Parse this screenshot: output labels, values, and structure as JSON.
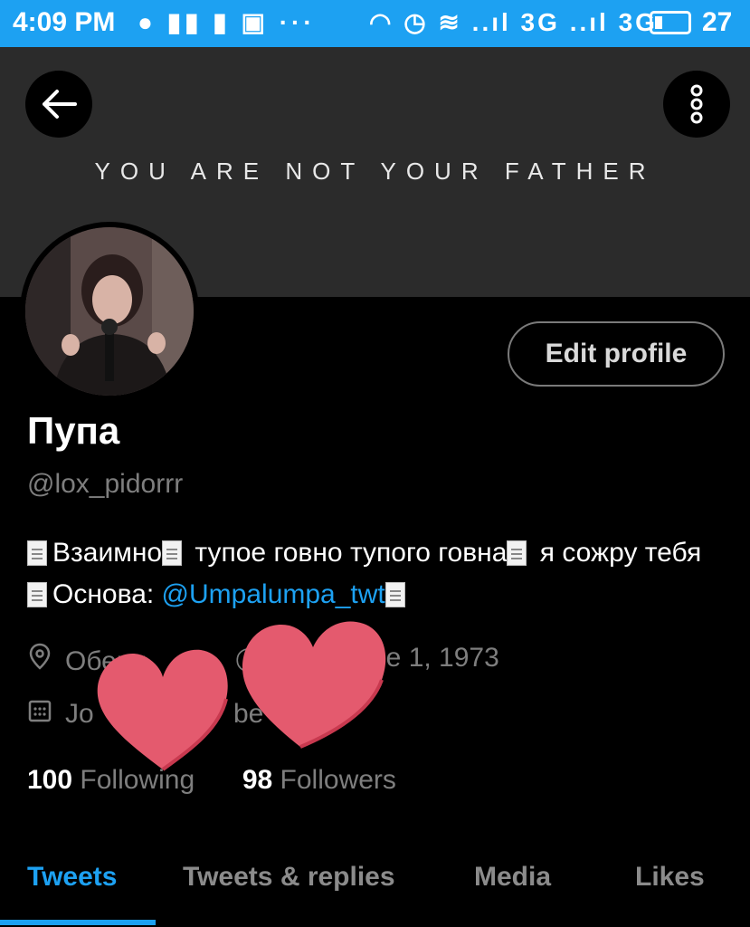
{
  "status_bar": {
    "time": "4:09 PM",
    "left_icons": "● ▮▮ ▮ ▣ ···",
    "right_icons": "◠ ◷ ≋ ..ıl 3G ..ıl 3G",
    "battery_level": "27"
  },
  "banner": {
    "text": "YOU ARE NOT YOUR FATHER",
    "back_icon": "arrow-left-icon",
    "more_icon": "more-vertical-icon"
  },
  "profile": {
    "edit_button": "Edit profile",
    "name": "Пупа",
    "handle": "@lox_pidorrr",
    "bio": {
      "part1": "Взаимно",
      "part2": " тупое говно тупого говна",
      "part3": " я сожру тебя",
      "part4": "Основа: ",
      "mention": "@Umpalumpa_twt"
    },
    "location": "Оберн",
    "birthdate": "ne 1, 1973",
    "joined": "Jo",
    "joined_tail": "be"
  },
  "stats": {
    "following_count": "100",
    "following_label": "Following",
    "followers_count": "98",
    "followers_label": "Followers"
  },
  "tabs": [
    {
      "label": "Tweets",
      "active": true
    },
    {
      "label": "Tweets & replies",
      "active": false
    },
    {
      "label": "Media",
      "active": false
    },
    {
      "label": "Likes",
      "active": false
    }
  ],
  "colors": {
    "accent": "#1da1f2",
    "heart": "#e45a6e"
  }
}
